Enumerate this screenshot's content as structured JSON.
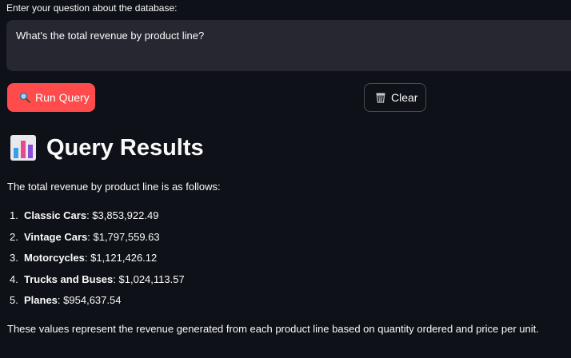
{
  "question": {
    "label": "Enter your question about the database:",
    "value": "What's the total revenue by product line?"
  },
  "buttons": {
    "run_label": "Run Query",
    "run_icon": "magnifying-glass-icon",
    "clear_label": "Clear",
    "clear_icon": "wastebasket-icon",
    "run_color": "#ff4b4b"
  },
  "results": {
    "heading": "Query Results",
    "heading_icon": "bar-chart-icon",
    "intro": "The total revenue by product line is as follows:",
    "items": [
      {
        "number": "1.",
        "name": "Classic Cars",
        "value": "$3,853,922.49"
      },
      {
        "number": "2.",
        "name": "Vintage Cars",
        "value": "$1,797,559.63"
      },
      {
        "number": "3.",
        "name": "Motorcycles",
        "value": "$1,121,426.12"
      },
      {
        "number": "4.",
        "name": "Trucks and Buses",
        "value": "$1,024,113.57"
      },
      {
        "number": "5.",
        "name": "Planes",
        "value": "$954,637.54"
      }
    ],
    "outro": "These values represent the revenue generated from each product line based on quantity ordered and price per unit."
  },
  "theme": {
    "background": "#0e1117",
    "input_background": "#262730",
    "text": "#fafafa"
  }
}
